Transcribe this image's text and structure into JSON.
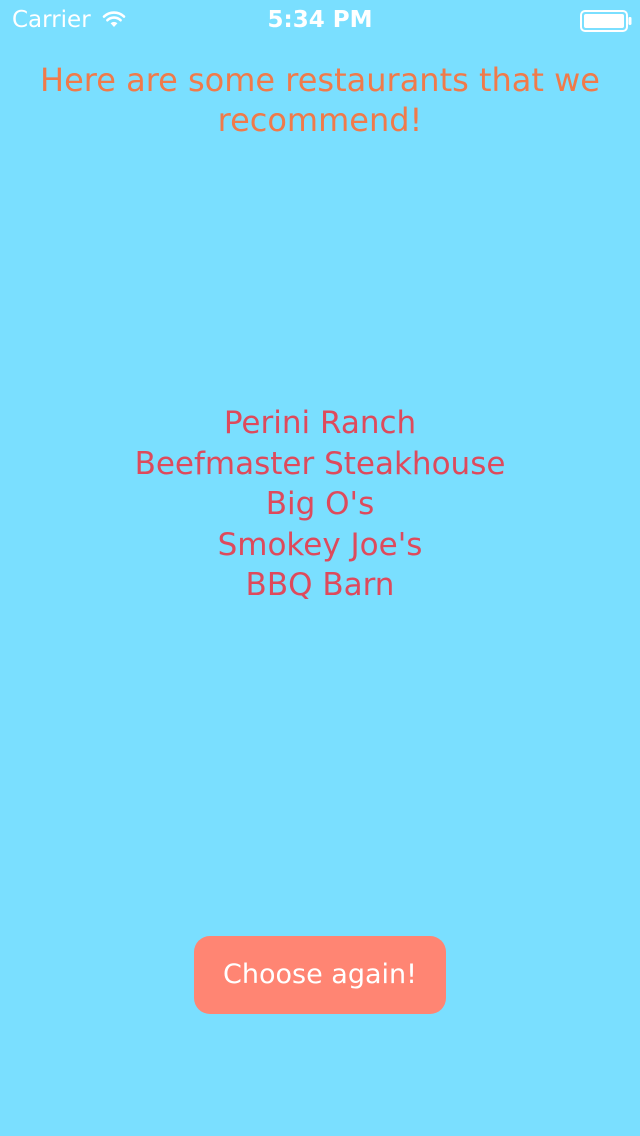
{
  "status_bar": {
    "carrier": "Carrier",
    "time": "5:34 PM",
    "wifi_icon": "wifi-icon",
    "battery_icon": "battery-icon"
  },
  "heading": "Here are some restaurants that we recommend!",
  "restaurants": [
    "Perini Ranch",
    "Beefmaster Steakhouse",
    "Big O's",
    "Smokey Joe's",
    "BBQ Barn"
  ],
  "button": {
    "label": "Choose again!"
  },
  "colors": {
    "background": "#7ADFFF",
    "heading": "#F07A4A",
    "restaurant_text": "#DE4A5C",
    "button_background": "#FF8573",
    "button_text": "#FFFFFF"
  }
}
